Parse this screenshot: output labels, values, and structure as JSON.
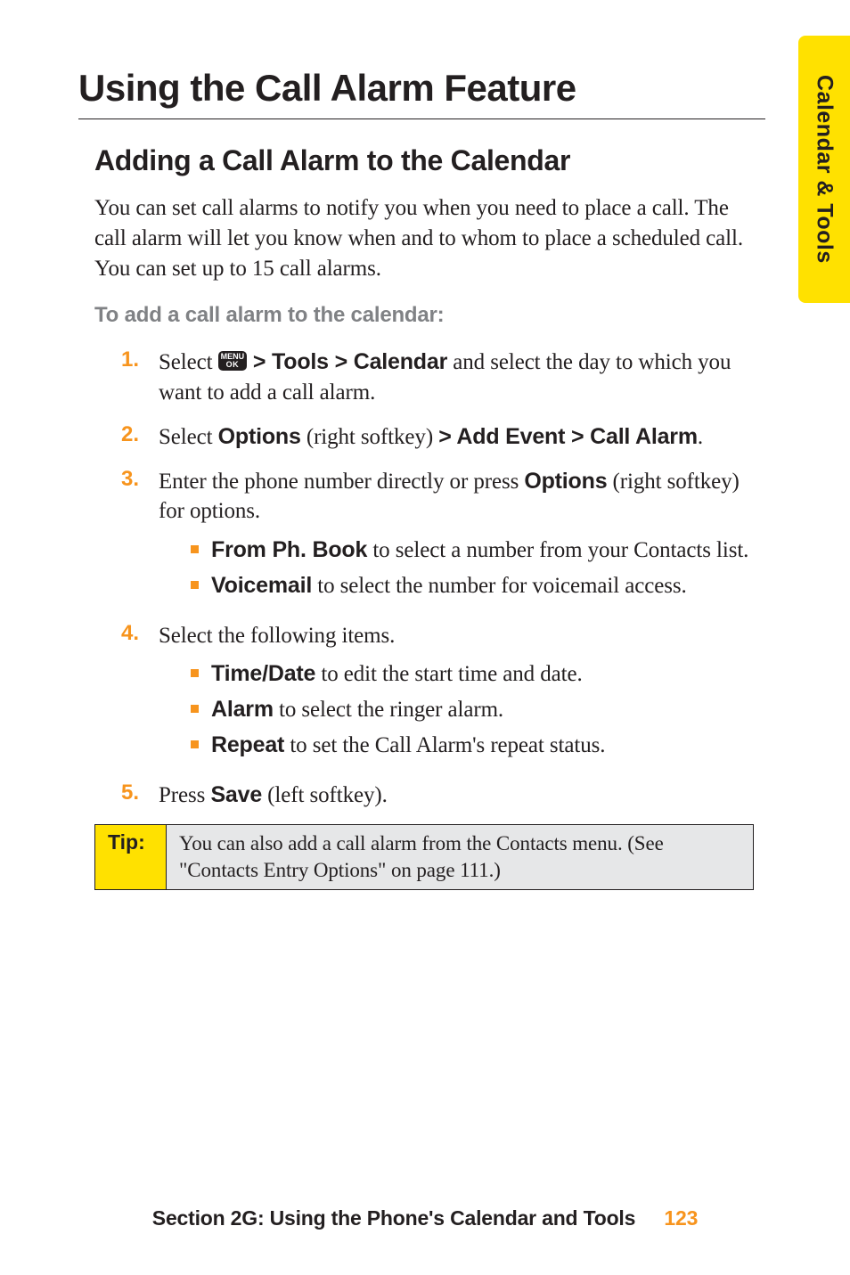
{
  "side_tab": "Calendar & Tools",
  "h1": "Using the Call Alarm Feature",
  "h2": "Adding a Call Alarm to the Calendar",
  "intro": "You can set call alarms to notify you when you need to place a call. The call alarm will let you know when and to whom to place a scheduled call. You can set up to 15 call alarms.",
  "todo": "To add a call alarm to the calendar:",
  "menu_key": {
    "line1": "MENU",
    "line2": "OK"
  },
  "steps": [
    {
      "num": "1.",
      "pre": "Select ",
      "post_bold": " > Tools > Calendar",
      "post_plain": " and select the day to which you want to add a call alarm.",
      "has_key": true
    },
    {
      "num": "2.",
      "parts": [
        {
          "t": "Select ",
          "b": false
        },
        {
          "t": "Options",
          "b": true
        },
        {
          "t": " (right softkey) ",
          "b": false
        },
        {
          "t": "> Add Event > Call Alarm",
          "b": true
        },
        {
          "t": ".",
          "b": false
        }
      ]
    },
    {
      "num": "3.",
      "parts": [
        {
          "t": "Enter the phone number directly or press ",
          "b": false
        },
        {
          "t": "Options",
          "b": true
        },
        {
          "t": " (right softkey) for options.",
          "b": false
        }
      ],
      "subs": [
        {
          "bold": "From Ph. Book",
          "rest": " to select a number from your Contacts list."
        },
        {
          "bold": "Voicemail",
          "rest": " to select the number for voicemail access."
        }
      ]
    },
    {
      "num": "4.",
      "parts": [
        {
          "t": "Select the following items.",
          "b": false
        }
      ],
      "subs": [
        {
          "bold": "Time/Date",
          "rest": " to edit the start time and date."
        },
        {
          "bold": "Alarm",
          "rest": " to select the ringer alarm."
        },
        {
          "bold": "Repeat",
          "rest": " to set the Call Alarm's repeat status."
        }
      ]
    },
    {
      "num": "5.",
      "parts": [
        {
          "t": "Press ",
          "b": false
        },
        {
          "t": "Save",
          "b": true
        },
        {
          "t": " (left softkey).",
          "b": false
        }
      ]
    }
  ],
  "tip": {
    "label": "Tip:",
    "body": "You can also add a call alarm from the Contacts menu. (See \"Contacts Entry Options\" on page 111.)"
  },
  "footer": {
    "section": "Section 2G: Using the Phone's Calendar and Tools",
    "page": "123"
  }
}
